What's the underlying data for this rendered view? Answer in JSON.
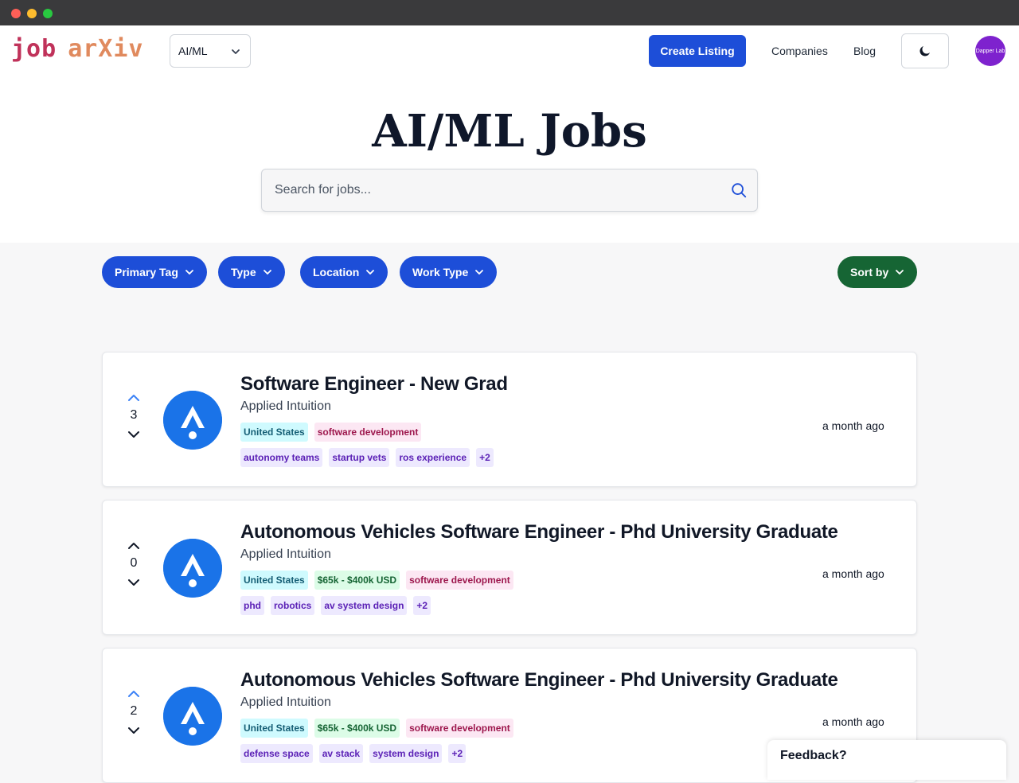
{
  "header": {
    "logo_job": "job",
    "logo_arxiv": "arXiv",
    "category_select": "AI/ML",
    "create_listing": "Create Listing",
    "nav": [
      "Companies",
      "Blog"
    ],
    "avatar_text": "Dapper Lab",
    "theme_icon": "moon-icon"
  },
  "hero": {
    "title": "AI/ML Jobs",
    "search_placeholder": "Search for jobs..."
  },
  "filters": {
    "pills": [
      "Primary Tag",
      "Type",
      "Location",
      "Work Type"
    ],
    "sort": "Sort by"
  },
  "colors": {
    "primary": "#1d4ed8",
    "sort": "#166534",
    "logo_job": "#c0325a",
    "logo_arxiv": "#e08a5e",
    "company_logo": "#1a73e8",
    "upvoted_arrow": "#3b82f6"
  },
  "jobs": [
    {
      "title": "Software Engineer - New Grad",
      "company": "Applied Intuition",
      "votes": "3",
      "upvoted": true,
      "tags_row1": [
        {
          "label": "United States",
          "kind": "loc"
        },
        {
          "label": "software development",
          "kind": "pri"
        }
      ],
      "tags_row2": [
        {
          "label": "autonomy teams",
          "kind": "sec"
        },
        {
          "label": "startup vets",
          "kind": "sec"
        },
        {
          "label": "ros experience",
          "kind": "sec"
        },
        {
          "label": "+2",
          "kind": "sec"
        }
      ],
      "posted": "a month ago"
    },
    {
      "title": "Autonomous Vehicles Software Engineer - Phd University Graduate",
      "company": "Applied Intuition",
      "votes": "0",
      "upvoted": false,
      "tags_row1": [
        {
          "label": "United States",
          "kind": "loc"
        },
        {
          "label": "$65k - $400k USD",
          "kind": "sal"
        },
        {
          "label": "software development",
          "kind": "pri"
        }
      ],
      "tags_row2": [
        {
          "label": "phd",
          "kind": "sec"
        },
        {
          "label": "robotics",
          "kind": "sec"
        },
        {
          "label": "av system design",
          "kind": "sec"
        },
        {
          "label": "+2",
          "kind": "sec"
        }
      ],
      "posted": "a month ago"
    },
    {
      "title": "Autonomous Vehicles Software Engineer - Phd University Graduate",
      "company": "Applied Intuition",
      "votes": "2",
      "upvoted": true,
      "tags_row1": [
        {
          "label": "United States",
          "kind": "loc"
        },
        {
          "label": "$65k - $400k USD",
          "kind": "sal"
        },
        {
          "label": "software development",
          "kind": "pri"
        }
      ],
      "tags_row2": [
        {
          "label": "defense space",
          "kind": "sec"
        },
        {
          "label": "av stack",
          "kind": "sec"
        },
        {
          "label": "system design",
          "kind": "sec"
        },
        {
          "label": "+2",
          "kind": "sec"
        }
      ],
      "posted": "a month ago"
    }
  ],
  "feedback": "Feedback?"
}
